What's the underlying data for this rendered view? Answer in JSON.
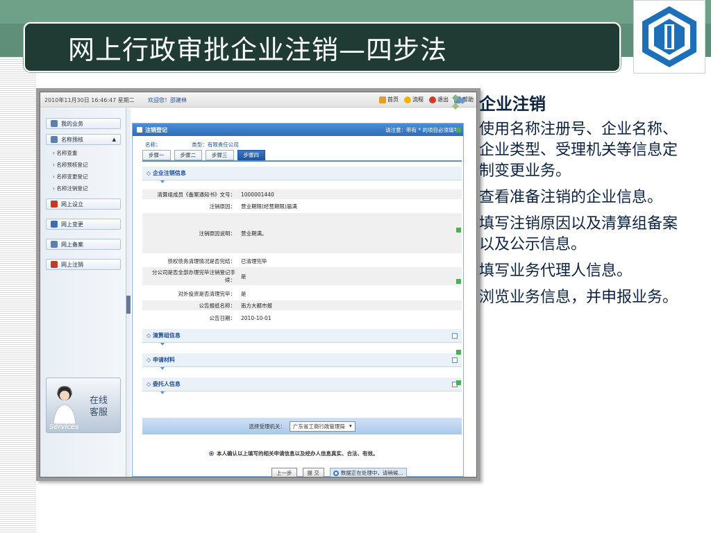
{
  "slide": {
    "title": "网上行政审批企业注销—四步法"
  },
  "screenshot": {
    "topbar": {
      "datetime": "2010年11月30日 16:46:47 星期二",
      "welcome": "欢迎您！邵建林",
      "links": [
        "首页",
        "流程",
        "退出",
        "帮助"
      ]
    },
    "sidebar": {
      "items": [
        "我的业务",
        "名称预核",
        "网上设立",
        "网上变更",
        "网上备案",
        "网上注销"
      ],
      "submenu": [
        "名称查重",
        "名称预核登记",
        "名称变更登记",
        "名称注销登记"
      ],
      "service": {
        "line1": "在线",
        "line2": "客服",
        "label": "Services"
      }
    },
    "panel": {
      "title": "注销登记",
      "note": "请注意：带有 * 的项目必须填写",
      "name_label": "名称：",
      "type_label": "类型：有限责任公司",
      "steps": [
        "步骤一",
        "步骤二",
        "步骤三",
        "步骤四"
      ],
      "section_enterprise": "企业注销信息",
      "rows": [
        {
          "label": "清算组成员《备案通知书》文号：",
          "value": "1000001440"
        },
        {
          "label": "注销原因：",
          "value": "营业期限(经营期限)届满"
        },
        {
          "label": "注销原因说明：",
          "value": "营业期满。"
        },
        {
          "label": "债权债务清理情况是否完结：",
          "value": "已清理完毕"
        },
        {
          "label": "分公司是否全部办理完毕注销登记手续：",
          "value": "是"
        },
        {
          "label": "对外投资是否清理完毕：",
          "value": "是"
        },
        {
          "label": "公告报纸名称：",
          "value": "南方大都市报"
        },
        {
          "label": "公告日期：",
          "value": "2010-10-01"
        }
      ],
      "section_liquidation": "清算组信息",
      "section_materials": "申请材料",
      "section_agent": "委托人信息",
      "authority_label": "选择受理机关：",
      "authority_value": "广东省工商行政管理局",
      "confirm_text": "本人确认以上填写的相关申请信息以及经办人信息真实、合法、有效。",
      "btn_prev": "上一步",
      "btn_submit": "提 交",
      "busy_text": "数据正在处理中，请稍候..."
    }
  },
  "bullets": {
    "heading": "企业注销",
    "items": [
      "使用名称注册号、企业名称、企业类型、受理机关等信息定制变更业务。",
      "查看准备注销的企业信息。",
      "填写注销原因以及清算组备案以及公示信息。",
      "填写业务代理人信息。",
      "浏览业务信息，并申报业务。"
    ]
  }
}
